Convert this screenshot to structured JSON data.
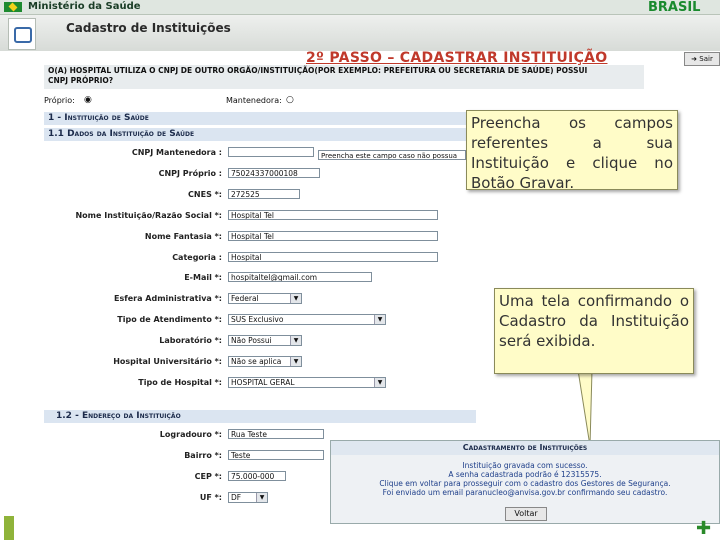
{
  "header": {
    "ministry": "Ministério da Saúde",
    "brand_logo": "BRASIL",
    "section_title": "Cadastro de Instituições",
    "exit_label": "Sair"
  },
  "step_title": "2º PASSO – CADASTRAR INSTITUIÇÃO",
  "question": {
    "line1": "O(A) HOSPITAL UTILIZA O CNPJ DE OUTRO ORGÃO/INSTITUIÇÃO(POR EXEMPLO: PREFEITURA OU SECRETARIA DE SAÚDE) POSSUI",
    "line2": "CNPJ PRÓPRIO?",
    "option_own": "Próprio:",
    "option_maintainer": "Mantenedora:"
  },
  "section1": {
    "title": "1 - Instituição de Saúde",
    "subtitle": "1.1   Dados da Instituição de Saúde"
  },
  "form": [
    {
      "label": "CNPJ Mantenedora :",
      "value": "",
      "kind": "input"
    },
    {
      "label": "CNPJ Próprio :",
      "value": "75024337000108",
      "kind": "input"
    },
    {
      "label": "CNES *:",
      "value": "272525",
      "kind": "input"
    },
    {
      "label": "Nome Instituição/Razão Social *:",
      "value": "Hospital Tel",
      "kind": "input"
    },
    {
      "label": "Nome Fantasia *:",
      "value": "Hospital Tel",
      "kind": "input"
    },
    {
      "label": "Categoria :",
      "value": "Hospital",
      "kind": "input"
    },
    {
      "label": "E-Mail *:",
      "value": "hospitaltel@gmail.com",
      "kind": "input"
    },
    {
      "label": "Esfera Administrativa *:",
      "value": "Federal",
      "kind": "select"
    },
    {
      "label": "Tipo de Atendimento *:",
      "value": "SUS Exclusivo",
      "kind": "select"
    },
    {
      "label": "Laboratório *:",
      "value": "Não Possui",
      "kind": "select"
    },
    {
      "label": "Hospital Universitário *:",
      "value": "Não se aplica",
      "kind": "select"
    },
    {
      "label": "Tipo de Hospital *:",
      "value": "HOSPITAL GERAL",
      "kind": "select"
    }
  ],
  "cnpj_hint": "Preencha este campo caso não possua",
  "section2": {
    "title": "1.2 - Endereço da Instituição"
  },
  "address": [
    {
      "label": "Logradouro *:",
      "value": "Rua Teste"
    },
    {
      "label": "Bairro *:",
      "value": "Teste"
    },
    {
      "label": "CEP *:",
      "value": "75.000-000"
    },
    {
      "label": "UF *:",
      "value": "DF"
    }
  ],
  "callout1": "Preencha os campos referentes a sua Instituição e clique no Botão Gravar.",
  "callout2": "Uma tela confirmando o Cadastro da Instituição será exibida.",
  "dialog": {
    "title": "Cadastramento de Instituições",
    "line1": "Instituição gravada com sucesso.",
    "line2": "A senha cadastrada podrão é 12315575.",
    "line3": "Clique em voltar para prosseguir com o cadastro dos Gestores de Segurança.",
    "line4": "Foi enviado um email paranucleo@anvisa.gov.br confirmando seu cadastro.",
    "button": "Voltar"
  },
  "colors": {
    "accent_red": "#c0392b",
    "callout_bg": "#fffcc8",
    "header_blue": "#dbe5f1"
  }
}
